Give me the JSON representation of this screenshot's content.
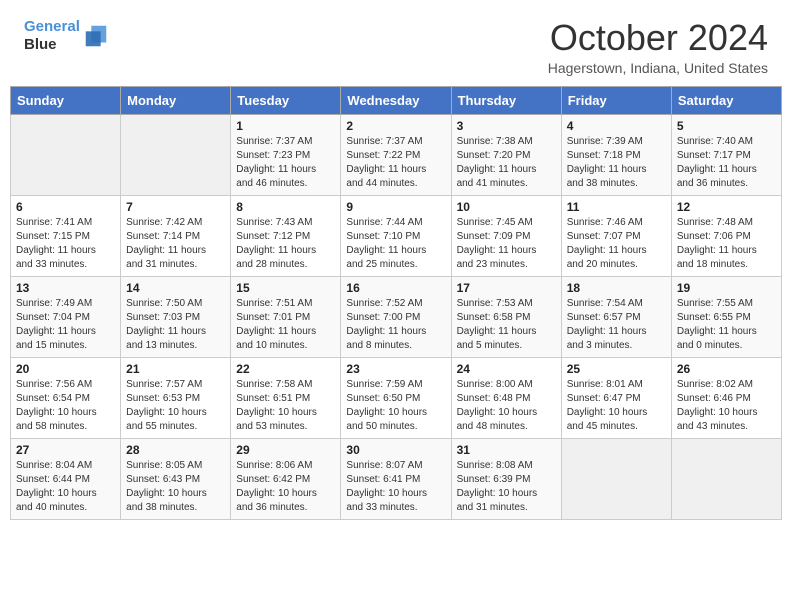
{
  "header": {
    "logo_line1": "General",
    "logo_line2": "Blue",
    "title": "October 2024",
    "location": "Hagerstown, Indiana, United States"
  },
  "weekdays": [
    "Sunday",
    "Monday",
    "Tuesday",
    "Wednesday",
    "Thursday",
    "Friday",
    "Saturday"
  ],
  "weeks": [
    [
      {
        "day": "",
        "sunrise": "",
        "sunset": "",
        "daylight": ""
      },
      {
        "day": "",
        "sunrise": "",
        "sunset": "",
        "daylight": ""
      },
      {
        "day": "1",
        "sunrise": "Sunrise: 7:37 AM",
        "sunset": "Sunset: 7:23 PM",
        "daylight": "Daylight: 11 hours and 46 minutes."
      },
      {
        "day": "2",
        "sunrise": "Sunrise: 7:37 AM",
        "sunset": "Sunset: 7:22 PM",
        "daylight": "Daylight: 11 hours and 44 minutes."
      },
      {
        "day": "3",
        "sunrise": "Sunrise: 7:38 AM",
        "sunset": "Sunset: 7:20 PM",
        "daylight": "Daylight: 11 hours and 41 minutes."
      },
      {
        "day": "4",
        "sunrise": "Sunrise: 7:39 AM",
        "sunset": "Sunset: 7:18 PM",
        "daylight": "Daylight: 11 hours and 38 minutes."
      },
      {
        "day": "5",
        "sunrise": "Sunrise: 7:40 AM",
        "sunset": "Sunset: 7:17 PM",
        "daylight": "Daylight: 11 hours and 36 minutes."
      }
    ],
    [
      {
        "day": "6",
        "sunrise": "Sunrise: 7:41 AM",
        "sunset": "Sunset: 7:15 PM",
        "daylight": "Daylight: 11 hours and 33 minutes."
      },
      {
        "day": "7",
        "sunrise": "Sunrise: 7:42 AM",
        "sunset": "Sunset: 7:14 PM",
        "daylight": "Daylight: 11 hours and 31 minutes."
      },
      {
        "day": "8",
        "sunrise": "Sunrise: 7:43 AM",
        "sunset": "Sunset: 7:12 PM",
        "daylight": "Daylight: 11 hours and 28 minutes."
      },
      {
        "day": "9",
        "sunrise": "Sunrise: 7:44 AM",
        "sunset": "Sunset: 7:10 PM",
        "daylight": "Daylight: 11 hours and 25 minutes."
      },
      {
        "day": "10",
        "sunrise": "Sunrise: 7:45 AM",
        "sunset": "Sunset: 7:09 PM",
        "daylight": "Daylight: 11 hours and 23 minutes."
      },
      {
        "day": "11",
        "sunrise": "Sunrise: 7:46 AM",
        "sunset": "Sunset: 7:07 PM",
        "daylight": "Daylight: 11 hours and 20 minutes."
      },
      {
        "day": "12",
        "sunrise": "Sunrise: 7:48 AM",
        "sunset": "Sunset: 7:06 PM",
        "daylight": "Daylight: 11 hours and 18 minutes."
      }
    ],
    [
      {
        "day": "13",
        "sunrise": "Sunrise: 7:49 AM",
        "sunset": "Sunset: 7:04 PM",
        "daylight": "Daylight: 11 hours and 15 minutes."
      },
      {
        "day": "14",
        "sunrise": "Sunrise: 7:50 AM",
        "sunset": "Sunset: 7:03 PM",
        "daylight": "Daylight: 11 hours and 13 minutes."
      },
      {
        "day": "15",
        "sunrise": "Sunrise: 7:51 AM",
        "sunset": "Sunset: 7:01 PM",
        "daylight": "Daylight: 11 hours and 10 minutes."
      },
      {
        "day": "16",
        "sunrise": "Sunrise: 7:52 AM",
        "sunset": "Sunset: 7:00 PM",
        "daylight": "Daylight: 11 hours and 8 minutes."
      },
      {
        "day": "17",
        "sunrise": "Sunrise: 7:53 AM",
        "sunset": "Sunset: 6:58 PM",
        "daylight": "Daylight: 11 hours and 5 minutes."
      },
      {
        "day": "18",
        "sunrise": "Sunrise: 7:54 AM",
        "sunset": "Sunset: 6:57 PM",
        "daylight": "Daylight: 11 hours and 3 minutes."
      },
      {
        "day": "19",
        "sunrise": "Sunrise: 7:55 AM",
        "sunset": "Sunset: 6:55 PM",
        "daylight": "Daylight: 11 hours and 0 minutes."
      }
    ],
    [
      {
        "day": "20",
        "sunrise": "Sunrise: 7:56 AM",
        "sunset": "Sunset: 6:54 PM",
        "daylight": "Daylight: 10 hours and 58 minutes."
      },
      {
        "day": "21",
        "sunrise": "Sunrise: 7:57 AM",
        "sunset": "Sunset: 6:53 PM",
        "daylight": "Daylight: 10 hours and 55 minutes."
      },
      {
        "day": "22",
        "sunrise": "Sunrise: 7:58 AM",
        "sunset": "Sunset: 6:51 PM",
        "daylight": "Daylight: 10 hours and 53 minutes."
      },
      {
        "day": "23",
        "sunrise": "Sunrise: 7:59 AM",
        "sunset": "Sunset: 6:50 PM",
        "daylight": "Daylight: 10 hours and 50 minutes."
      },
      {
        "day": "24",
        "sunrise": "Sunrise: 8:00 AM",
        "sunset": "Sunset: 6:48 PM",
        "daylight": "Daylight: 10 hours and 48 minutes."
      },
      {
        "day": "25",
        "sunrise": "Sunrise: 8:01 AM",
        "sunset": "Sunset: 6:47 PM",
        "daylight": "Daylight: 10 hours and 45 minutes."
      },
      {
        "day": "26",
        "sunrise": "Sunrise: 8:02 AM",
        "sunset": "Sunset: 6:46 PM",
        "daylight": "Daylight: 10 hours and 43 minutes."
      }
    ],
    [
      {
        "day": "27",
        "sunrise": "Sunrise: 8:04 AM",
        "sunset": "Sunset: 6:44 PM",
        "daylight": "Daylight: 10 hours and 40 minutes."
      },
      {
        "day": "28",
        "sunrise": "Sunrise: 8:05 AM",
        "sunset": "Sunset: 6:43 PM",
        "daylight": "Daylight: 10 hours and 38 minutes."
      },
      {
        "day": "29",
        "sunrise": "Sunrise: 8:06 AM",
        "sunset": "Sunset: 6:42 PM",
        "daylight": "Daylight: 10 hours and 36 minutes."
      },
      {
        "day": "30",
        "sunrise": "Sunrise: 8:07 AM",
        "sunset": "Sunset: 6:41 PM",
        "daylight": "Daylight: 10 hours and 33 minutes."
      },
      {
        "day": "31",
        "sunrise": "Sunrise: 8:08 AM",
        "sunset": "Sunset: 6:39 PM",
        "daylight": "Daylight: 10 hours and 31 minutes."
      },
      {
        "day": "",
        "sunrise": "",
        "sunset": "",
        "daylight": ""
      },
      {
        "day": "",
        "sunrise": "",
        "sunset": "",
        "daylight": ""
      }
    ]
  ]
}
